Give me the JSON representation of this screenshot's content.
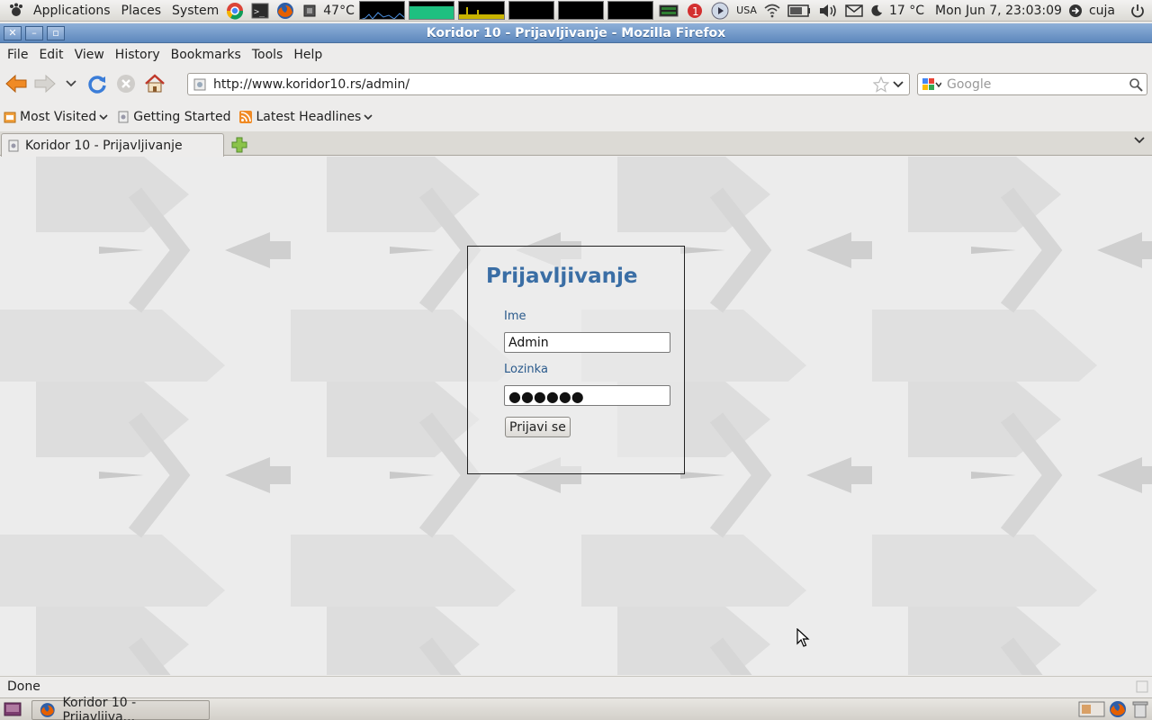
{
  "top_panel": {
    "menus": [
      "Applications",
      "Places",
      "System"
    ],
    "cpu_temp": "47°C",
    "keyboard_layout": "USA",
    "weather": "17 °C",
    "clock": "Mon Jun  7, 23:03:09",
    "user": "cuja",
    "notification_count": "1"
  },
  "window": {
    "title": "Koridor 10 - Prijavljivanje - Mozilla Firefox"
  },
  "menubar": {
    "items": [
      "File",
      "Edit",
      "View",
      "History",
      "Bookmarks",
      "Tools",
      "Help"
    ]
  },
  "navigation": {
    "url": "http://www.koridor10.rs/admin/",
    "search_placeholder": "Google"
  },
  "bookmarks": {
    "items": [
      "Most Visited",
      "Getting Started",
      "Latest Headlines"
    ]
  },
  "tabs": {
    "active": "Koridor 10 - Prijavljivanje"
  },
  "login": {
    "title": "Prijavljivanje",
    "username_label": "Ime",
    "username_value": "Admin",
    "password_label": "Lozinka",
    "password_mask": "●●●●●●",
    "submit_label": "Prijavi se"
  },
  "status": {
    "text": "Done"
  },
  "taskbar": {
    "item_label": "Koridor 10 - Prijavljiva..."
  },
  "colors": {
    "heading": "#3a6ea5",
    "label": "#2a5a8c",
    "titlebar": "#6f96c8"
  }
}
